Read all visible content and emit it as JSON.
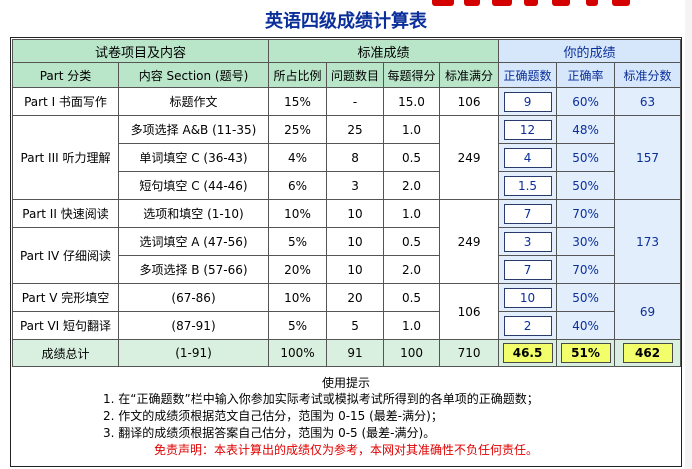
{
  "title": "英语四级成绩计算表",
  "colors": {
    "title": "#0b2f9a",
    "header_green": "#b9e5c9",
    "header_blue": "#d6e6fb",
    "total_highlight": "#f3ff6a",
    "disclaimer": "#e00000"
  },
  "groups": {
    "paper": "试卷项目及内容",
    "standard": "标准成绩",
    "yours": "你的成绩"
  },
  "columns": {
    "part": "Part 分类",
    "section": "内容 Section (题号)",
    "ratio": "所占比例",
    "count": "问题数目",
    "per": "每题得分",
    "full": "标准满分",
    "correct": "正确题数",
    "rate": "正确率",
    "score": "标准分数"
  },
  "rows": [
    {
      "part": "Part I 书面写作",
      "section": "标题作文",
      "ratio": "15%",
      "count": "-",
      "per": "15.0",
      "full": "106",
      "correct": "9",
      "rate": "60%",
      "score": "63"
    },
    {
      "part": "Part III 听力理解",
      "section": "多项选择 A&B (11-35)",
      "ratio": "25%",
      "count": "25",
      "per": "1.0",
      "full": "249",
      "correct": "12",
      "rate": "48%",
      "score": "157"
    },
    {
      "section": "单词填空 C (36-43)",
      "ratio": "4%",
      "count": "8",
      "per": "0.5",
      "correct": "4",
      "rate": "50%"
    },
    {
      "section": "短句填空 C (44-46)",
      "ratio": "6%",
      "count": "3",
      "per": "2.0",
      "correct": "1.5",
      "rate": "50%"
    },
    {
      "part": "Part II 快速阅读",
      "section": "选项和填空 (1-10)",
      "ratio": "10%",
      "count": "10",
      "per": "1.0",
      "full": "249",
      "correct": "7",
      "rate": "70%",
      "score": "173"
    },
    {
      "part": "Part IV 仔细阅读",
      "section": "选词填空 A (47-56)",
      "ratio": "5%",
      "count": "10",
      "per": "0.5",
      "correct": "3",
      "rate": "30%"
    },
    {
      "section": "多项选择 B (57-66)",
      "ratio": "20%",
      "count": "10",
      "per": "2.0",
      "correct": "7",
      "rate": "70%"
    },
    {
      "part": "Part V 完形填空",
      "section": "(67-86)",
      "ratio": "10%",
      "count": "20",
      "per": "0.5",
      "full": "106",
      "correct": "10",
      "rate": "50%",
      "score": "69"
    },
    {
      "part": "Part VI 短句翻译",
      "section": "(87-91)",
      "ratio": "5%",
      "count": "5",
      "per": "1.0",
      "correct": "2",
      "rate": "40%"
    }
  ],
  "total": {
    "label": "成绩总计",
    "section": "(1-91)",
    "ratio": "100%",
    "count": "91",
    "per": "100",
    "full": "710",
    "correct": "46.5",
    "rate": "51%",
    "score": "462"
  },
  "notes": {
    "head": "使用提示",
    "lines": [
      "1. 在“正确题数”栏中输入你参加实际考试或模拟考试所得到的各单项的正确题数；",
      "2. 作文的成绩须根据范文自己估分，范围为 0-15 (最差-满分)；",
      "3. 翻译的成绩须根据答案自己估分，范围为 0-5 (最差-满分)。"
    ],
    "disclaimer": "免责声明：本表计算出的成绩仅为参考，本网对其准确性不负任何责任。"
  }
}
